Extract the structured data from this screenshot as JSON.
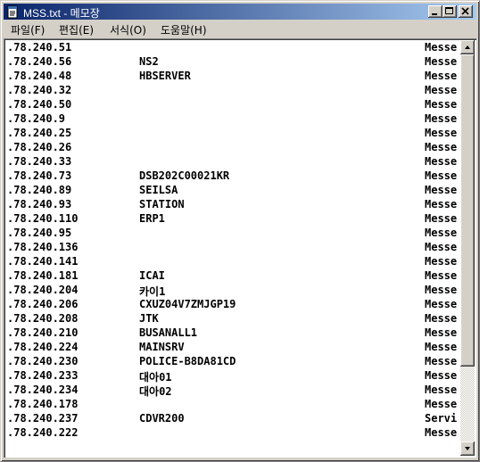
{
  "window": {
    "title": "MSS.txt - 메모장"
  },
  "menu": [
    {
      "label": "파일(F)"
    },
    {
      "label": "편집(E)"
    },
    {
      "label": "서식(O)"
    },
    {
      "label": "도움말(H)"
    }
  ],
  "lines": [
    {
      "ip": ".78.240.51",
      "host": "",
      "type": "Messe"
    },
    {
      "ip": ".78.240.56",
      "host": "NS2",
      "type": "Messe"
    },
    {
      "ip": ".78.240.48",
      "host": "HBSERVER",
      "type": "Messe"
    },
    {
      "ip": ".78.240.32",
      "host": "",
      "type": "Messe"
    },
    {
      "ip": ".78.240.50",
      "host": "",
      "type": "Messe"
    },
    {
      "ip": ".78.240.9",
      "host": "",
      "type": "Messe"
    },
    {
      "ip": ".78.240.25",
      "host": "",
      "type": "Messe"
    },
    {
      "ip": ".78.240.26",
      "host": "",
      "type": "Messe"
    },
    {
      "ip": ".78.240.33",
      "host": "",
      "type": "Messe"
    },
    {
      "ip": ".78.240.73",
      "host": "DSB202C00021KR",
      "type": "Messe"
    },
    {
      "ip": ".78.240.89",
      "host": "SEILSA",
      "type": "Messe"
    },
    {
      "ip": ".78.240.93",
      "host": "STATION",
      "type": "Messe"
    },
    {
      "ip": ".78.240.110",
      "host": "ERP1",
      "type": "Messe"
    },
    {
      "ip": ".78.240.95",
      "host": "",
      "type": "Messe"
    },
    {
      "ip": ".78.240.136",
      "host": "",
      "type": "Messe"
    },
    {
      "ip": ".78.240.141",
      "host": "",
      "type": "Messe"
    },
    {
      "ip": ".78.240.181",
      "host": "ICAI",
      "type": "Messe"
    },
    {
      "ip": ".78.240.204",
      "host": "카이1",
      "type": "Messe"
    },
    {
      "ip": ".78.240.206",
      "host": "CXUZ04V7ZMJGP19",
      "type": "Messe"
    },
    {
      "ip": ".78.240.208",
      "host": "JTK",
      "type": "Messe"
    },
    {
      "ip": ".78.240.210",
      "host": "BUSANALL1",
      "type": "Messe"
    },
    {
      "ip": ".78.240.224",
      "host": "MAINSRV",
      "type": "Messe"
    },
    {
      "ip": ".78.240.230",
      "host": "POLICE-B8DA81CD",
      "type": "Messe"
    },
    {
      "ip": ".78.240.233",
      "host": "대아01",
      "type": "Messe"
    },
    {
      "ip": ".78.240.234",
      "host": "대아02",
      "type": "Messe"
    },
    {
      "ip": ".78.240.178",
      "host": "",
      "type": "Messe"
    },
    {
      "ip": ".78.240.237",
      "host": "CDVR200",
      "type": "Servi"
    },
    {
      "ip": ".78.240.222",
      "host": "",
      "type": "Messe"
    }
  ],
  "icons": {
    "app": "notepad-icon",
    "minimize": "minimize-icon",
    "maximize": "maximize-icon",
    "close": "close-icon",
    "scroll_up": "arrow-up-icon",
    "scroll_down": "arrow-down-icon"
  },
  "colors": {
    "titlebar_start": "#0a246a",
    "titlebar_end": "#a6caf0",
    "face": "#d4d0c8"
  }
}
